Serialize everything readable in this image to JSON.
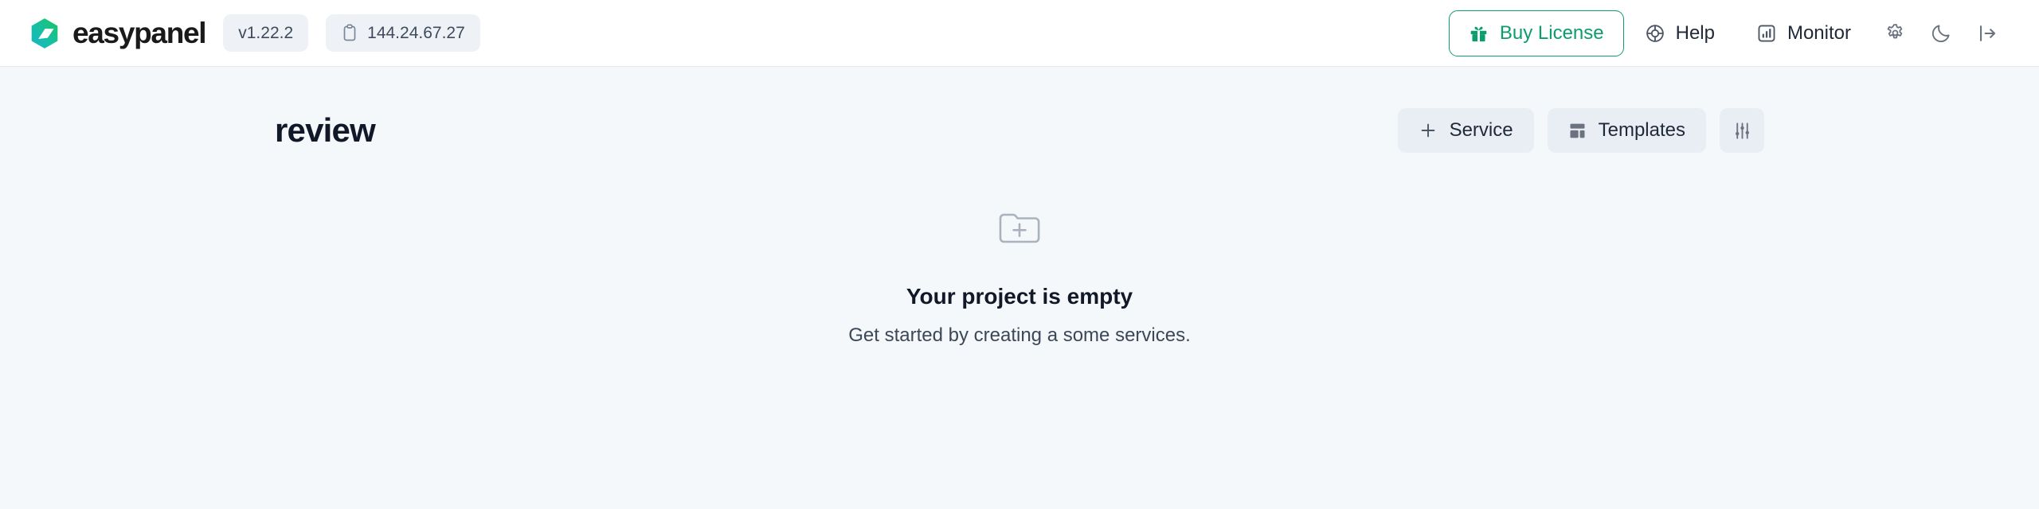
{
  "header": {
    "brand": "easypanel",
    "logo_icon": "easypanel-hexagon-logo",
    "version_badge": {
      "label": "v1.22.2"
    },
    "ip_badge": {
      "label": "144.24.67.27",
      "icon": "clipboard-icon"
    },
    "buy_license": {
      "label": "Buy License",
      "icon": "gift-icon",
      "color": "#0b9e6b"
    },
    "help": {
      "label": "Help",
      "icon": "lifebuoy-icon"
    },
    "monitor": {
      "label": "Monitor",
      "icon": "chart-square-icon"
    },
    "settings_icon": "gear-icon",
    "theme_icon": "moon-icon",
    "logout_icon": "logout-icon"
  },
  "page": {
    "title": "review",
    "actions": {
      "service": {
        "label": "Service",
        "icon": "plus-icon"
      },
      "templates": {
        "label": "Templates",
        "icon": "layout-dashboard-icon"
      },
      "filters": {
        "icon": "sliders-icon"
      }
    },
    "empty_state": {
      "icon": "folder-plus-icon",
      "title": "Your project is empty",
      "subtitle": "Get started by creating a some services."
    }
  },
  "colors": {
    "page_background": "#f4f8fb",
    "header_background": "#ffffff",
    "accent_green": "#0b9e6b",
    "logo_teal": "#15b8b0",
    "logo_green": "#15c26a",
    "soft_button": "#e9eef5",
    "muted_text": "#6b7280"
  }
}
